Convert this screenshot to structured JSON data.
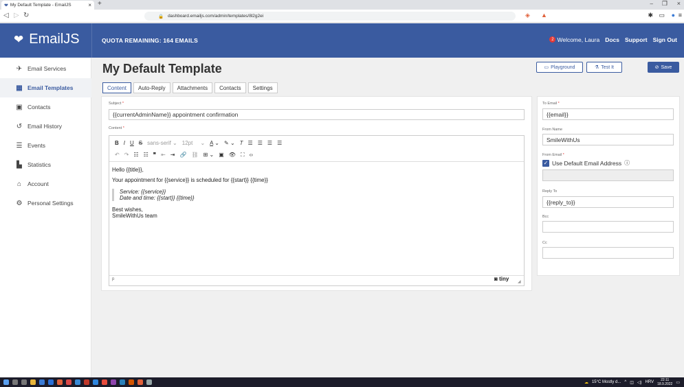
{
  "browser": {
    "tab_title": "My Default Template - EmailJS",
    "url": "dashboard.emailjs.com/admin/templates/8l2g2ei",
    "add_tab": "+"
  },
  "header": {
    "brand": "EmailJS",
    "quota": "QUOTA REMAINING: 164 EMAILS",
    "notif_count": "2",
    "welcome": "Welcome, Laura",
    "docs": "Docs",
    "support": "Support",
    "signout": "Sign Out"
  },
  "sidebar": {
    "items": [
      {
        "label": "Email Services",
        "icon": "send-icon"
      },
      {
        "label": "Email Templates",
        "icon": "templates-icon"
      },
      {
        "label": "Contacts",
        "icon": "contacts-icon"
      },
      {
        "label": "Email History",
        "icon": "history-icon"
      },
      {
        "label": "Events",
        "icon": "events-icon"
      },
      {
        "label": "Statistics",
        "icon": "statistics-icon"
      },
      {
        "label": "Account",
        "icon": "account-icon"
      },
      {
        "label": "Personal Settings",
        "icon": "settings-icon"
      }
    ]
  },
  "main": {
    "title": "My Default Template",
    "buttons": {
      "playground": "Playground",
      "test": "Test It",
      "save": "Save"
    },
    "tabs": [
      "Content",
      "Auto-Reply",
      "Attachments",
      "Contacts",
      "Settings"
    ],
    "subject_label": "Subject",
    "subject_value": "{{currentAdminName}} appointment confirmation",
    "content_label": "Content",
    "toolbar": {
      "font": "sans-serif",
      "size": "12pt"
    },
    "body": {
      "greeting": "Hello {{title}},",
      "line1": "Your appointment for {{service}} is scheduled for {{start}} {{time}}",
      "quote1": "Service: {{service}}",
      "quote2": "Date and time: {{start}} {{time}}",
      "closing1": "Best wishes,",
      "closing2": "SmileWithUs team"
    },
    "statusbar_path": "p",
    "tiny_brand": "tiny"
  },
  "right": {
    "to_label": "To Email",
    "to_value": "{{email}}",
    "from_name_label": "From Name",
    "from_name_value": "SmileWithUs",
    "from_email_label": "From Email",
    "use_default": "Use Default Email Address",
    "reply_label": "Reply To",
    "reply_value": "{{reply_to}}",
    "bcc_label": "Bcc",
    "cc_label": "Cc"
  },
  "taskbar": {
    "weather": "15°C  Mostly d...",
    "lang": "HRV",
    "time": "22:11",
    "date": "18.9.2022"
  },
  "colors": {
    "brand": "#3a5ba0",
    "required": "#e53935"
  }
}
